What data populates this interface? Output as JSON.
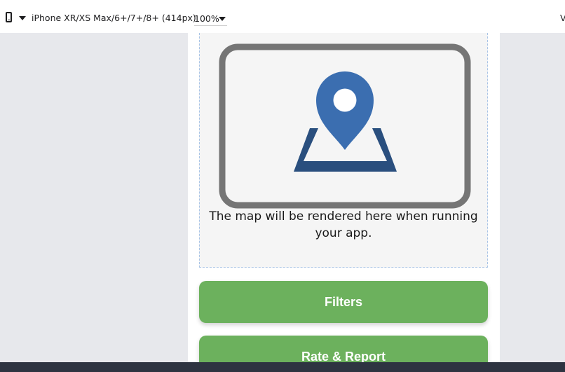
{
  "toolbar": {
    "device_icon": "phone-icon",
    "device_label": "iPhone XR/XS Max/6+/7+/8+ (414px)",
    "zoom_value": "100%",
    "right_cut_text": "V"
  },
  "map": {
    "icon": "map-pin-icon",
    "caption": "The map will be rendered here when running your app.",
    "colors": {
      "frame": "#757575",
      "pin": "#3b6eb0",
      "base": "#2a4f7e"
    }
  },
  "buttons": {
    "filters_label": "Filters",
    "rate_report_label": "Rate & Report",
    "color": "#6cb15d"
  }
}
